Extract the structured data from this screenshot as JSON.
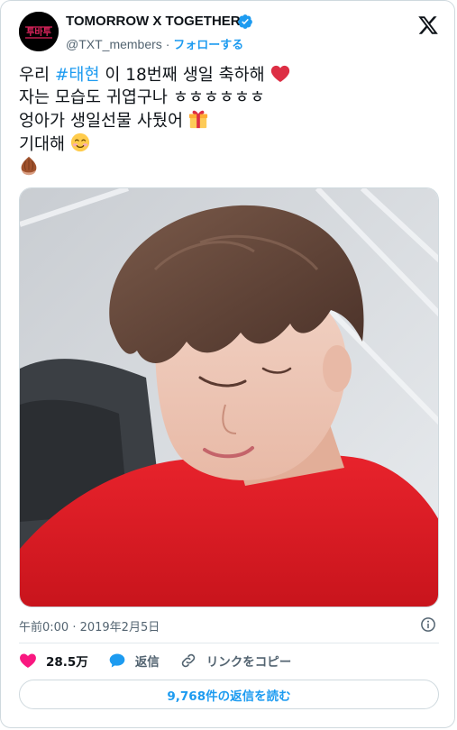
{
  "account": {
    "display_name": "TOMORROW X TOGETHER",
    "handle": "@TXT_members",
    "separator": "·",
    "follow_label": "フォローする",
    "avatar_text": "투바투"
  },
  "tweet": {
    "line1_pre": "우리 ",
    "line1_hashtag": "#태현",
    "line1_post": " 이 18번째 생일 축하해",
    "line2": "자는 모습도 귀엽구나 ㅎㅎㅎㅎㅎㅎ",
    "line3": "엉아가 생일선물 사뒀어",
    "line4": "기대해",
    "emojis": [
      "heart-emoji",
      "gift-emoji",
      "smiling-face-emoji",
      "chestnut-emoji"
    ]
  },
  "timestamp": "午前0:00 · 2019年2月5日",
  "actions": {
    "likes": "28.5万",
    "reply_label": "返信",
    "copy_link_label": "リンクをコピー"
  },
  "read_replies_label": "9,768件の返信を読む",
  "colors": {
    "accent": "#1d9bf0",
    "like": "#f91880",
    "text": "#0f1419",
    "muted": "#536471"
  }
}
